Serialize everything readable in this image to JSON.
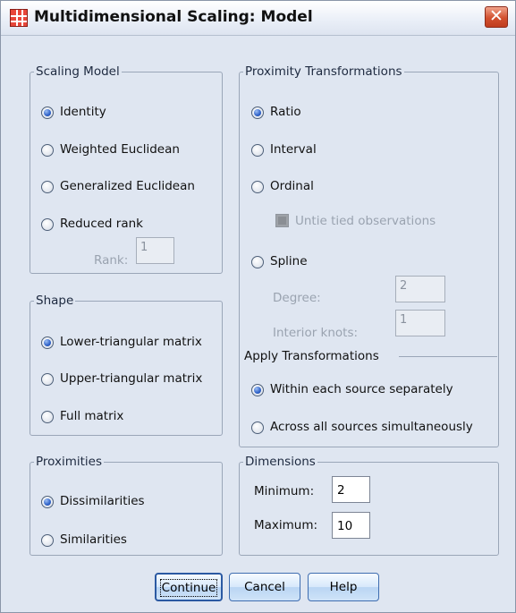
{
  "window": {
    "title": "Multidimensional Scaling: Model",
    "close_glyph": "✕"
  },
  "scaling_model": {
    "legend": "Scaling Model",
    "options": [
      "Identity",
      "Weighted Euclidean",
      "Generalized Euclidean",
      "Reduced rank"
    ],
    "selected": "Identity",
    "rank_label": "Rank:",
    "rank_value": "1"
  },
  "shape": {
    "legend": "Shape",
    "options": [
      "Lower-triangular matrix",
      "Upper-triangular matrix",
      "Full matrix"
    ],
    "selected": "Lower-triangular matrix"
  },
  "proximities": {
    "legend": "Proximities",
    "options": [
      "Dissimilarities",
      "Similarities"
    ],
    "selected": "Dissimilarities"
  },
  "proximity_transformations": {
    "legend": "Proximity Transformations",
    "options": [
      "Ratio",
      "Interval",
      "Ordinal",
      "Spline"
    ],
    "selected": "Ratio",
    "untie_label": "Untie tied observations",
    "degree_label": "Degree:",
    "degree_value": "2",
    "knots_label": "Interior knots:",
    "knots_value": "1"
  },
  "apply_transformations": {
    "label": "Apply Transformations",
    "options": [
      "Within each source separately",
      "Across all sources simultaneously"
    ],
    "selected": "Within each source separately"
  },
  "dimensions": {
    "legend": "Dimensions",
    "minimum_label": "Minimum:",
    "minimum_value": "2",
    "maximum_label": "Maximum:",
    "maximum_value": "10"
  },
  "buttons": {
    "continue": "Continue",
    "cancel": "Cancel",
    "help": "Help"
  },
  "colors": {
    "dialog_bg": "#dfe6f1",
    "radio_selected": "#2f62c9",
    "close_button": "#d2502f"
  }
}
